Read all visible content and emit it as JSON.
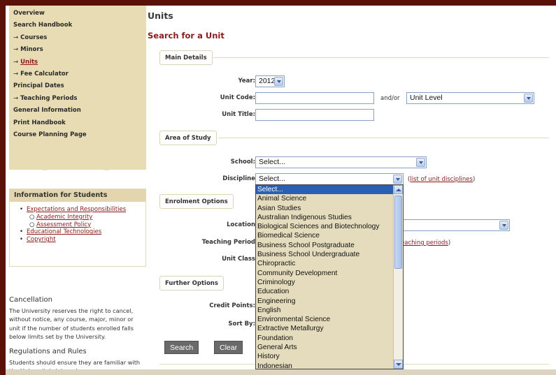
{
  "sidebar": {
    "nav": [
      {
        "label": "Overview",
        "sub": false,
        "active": false
      },
      {
        "label": "Search Handbook",
        "sub": false,
        "active": false
      },
      {
        "label": "Courses",
        "sub": true,
        "active": false
      },
      {
        "label": "Minors",
        "sub": true,
        "active": false
      },
      {
        "label": "Units",
        "sub": true,
        "active": true
      },
      {
        "label": "Fee Calculator",
        "sub": true,
        "active": false
      },
      {
        "label": "Principal Dates",
        "sub": false,
        "active": false
      },
      {
        "label": "Teaching Periods",
        "sub": true,
        "active": false
      },
      {
        "label": "General Information",
        "sub": false,
        "active": false
      },
      {
        "label": "Print Handbook",
        "sub": false,
        "active": false
      },
      {
        "label": "Course Planning Page",
        "sub": false,
        "active": false
      }
    ],
    "arrow": "→",
    "info": {
      "heading": "Information for Students",
      "links": [
        {
          "label": "Expectations and Responsibilities",
          "sub": false
        },
        {
          "label": "Academic Integrity",
          "sub": true
        },
        {
          "label": "Assessment Policy",
          "sub": true
        },
        {
          "label": "Educational Technologies",
          "sub": false
        },
        {
          "label": "Copyright",
          "sub": false
        }
      ]
    },
    "cancellation": {
      "heading": "Cancellation",
      "text": "The University reserves the right to cancel, without notice, any course, major, minor or unit if the number of students enrolled falls below limits set by the University."
    },
    "regulations": {
      "heading": "Regulations and Rules",
      "text": "Students should ensure they are familiar with the University's internal"
    }
  },
  "main": {
    "title": "Units",
    "subtitle": "Search for a Unit",
    "sections": {
      "main_details": "Main Details",
      "area_of_study": "Area of Study",
      "enrolment_options": "Enrolment Options",
      "further_options": "Further Options"
    },
    "labels": {
      "year": "Year:",
      "unit_code": "Unit Code:",
      "unit_title": "Unit Title:",
      "school": "School:",
      "discipline": "Discipline",
      "location": "Location",
      "teaching_period": "Teaching Period",
      "unit_class": "Unit Class",
      "credit_points": "Credit Points:",
      "sort_by": "Sort By:",
      "and_or": "and/or"
    },
    "values": {
      "year": "2012",
      "unit_code": "",
      "unit_title": "",
      "unit_level": "Unit Level",
      "school": "Select...",
      "discipline": "Select..."
    },
    "links": {
      "list_disciplines": "list of unit disciplines",
      "teaching_periods_tail": "eaching periods"
    },
    "buttons": {
      "search": "Search",
      "clear": "Clear"
    }
  },
  "dropdown": {
    "options": [
      "Select...",
      "Animal Science",
      "Asian Studies",
      "Australian Indigenous Studies",
      "Biological Sciences and Biotechnology",
      "Biomedical Science",
      "Business School Postgraduate",
      "Business School Undergraduate",
      "Chiropractic",
      "Community Development",
      "Criminology",
      "Education",
      "Engineering",
      "English",
      "Environmental Science",
      "Extractive Metallurgy",
      "Foundation",
      "General Arts",
      "History",
      "Indonesian"
    ],
    "selected_index": 0
  },
  "colors": {
    "brand_maroon": "#8b1a1a",
    "frame": "#5a1208",
    "sidebar_bg": "#e8dcb4",
    "highlight": "#2a5fb8"
  }
}
